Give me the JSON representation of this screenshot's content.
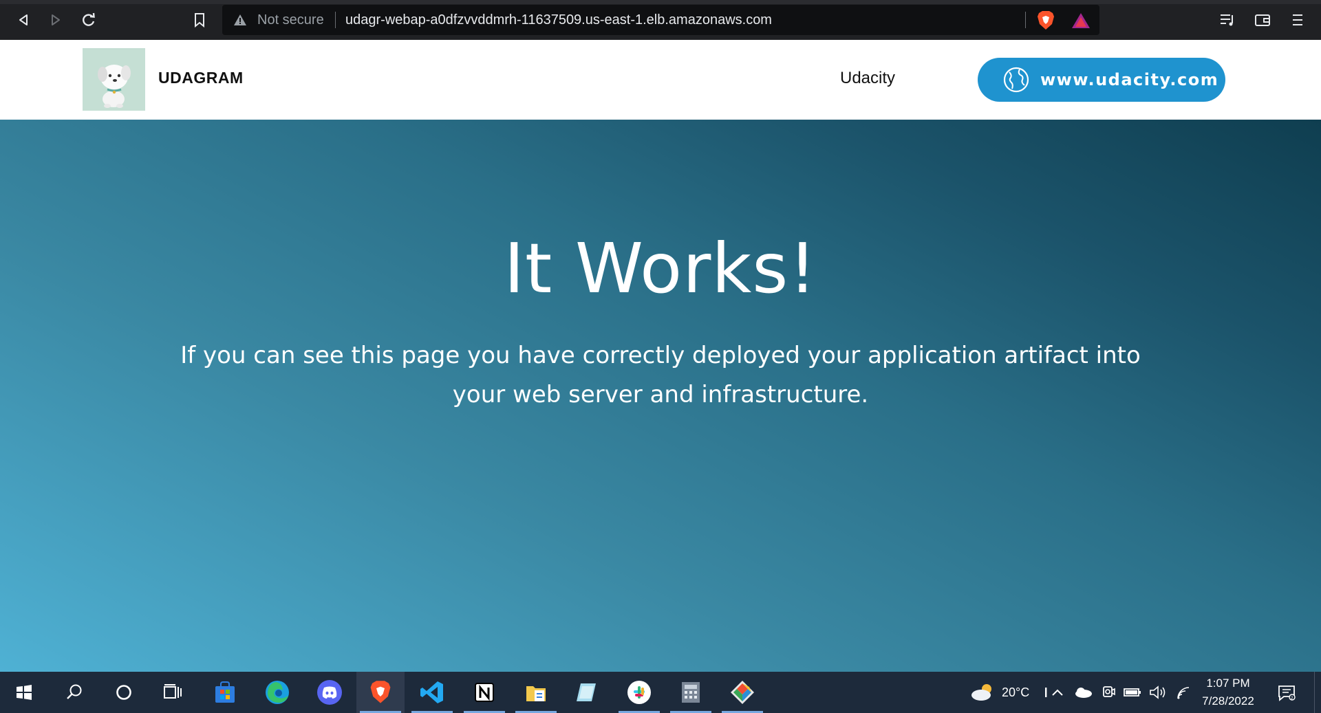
{
  "browser": {
    "security_label": "Not secure",
    "url": "udagr-webap-a0dfzvvddmrh-11637509.us-east-1.elb.amazonaws.com"
  },
  "site": {
    "brand": "UDAGRAM",
    "nav_link": "Udacity",
    "cta_label": "www.udacity.com",
    "accent_color": "#1f93cf"
  },
  "hero": {
    "title": "It Works!",
    "text": "If you can see this page you have correctly deployed your application artifact into your web server and infrastructure."
  },
  "taskbar": {
    "weather_temp": "20°C",
    "time": "1:07 PM",
    "date": "7/28/2022",
    "apps": [
      "windows-start",
      "search",
      "cortana",
      "task-view",
      "microsoft-store",
      "edge",
      "discord",
      "brave",
      "vscode",
      "notion",
      "file-explorer",
      "notes",
      "slack",
      "calculator",
      "git"
    ]
  }
}
